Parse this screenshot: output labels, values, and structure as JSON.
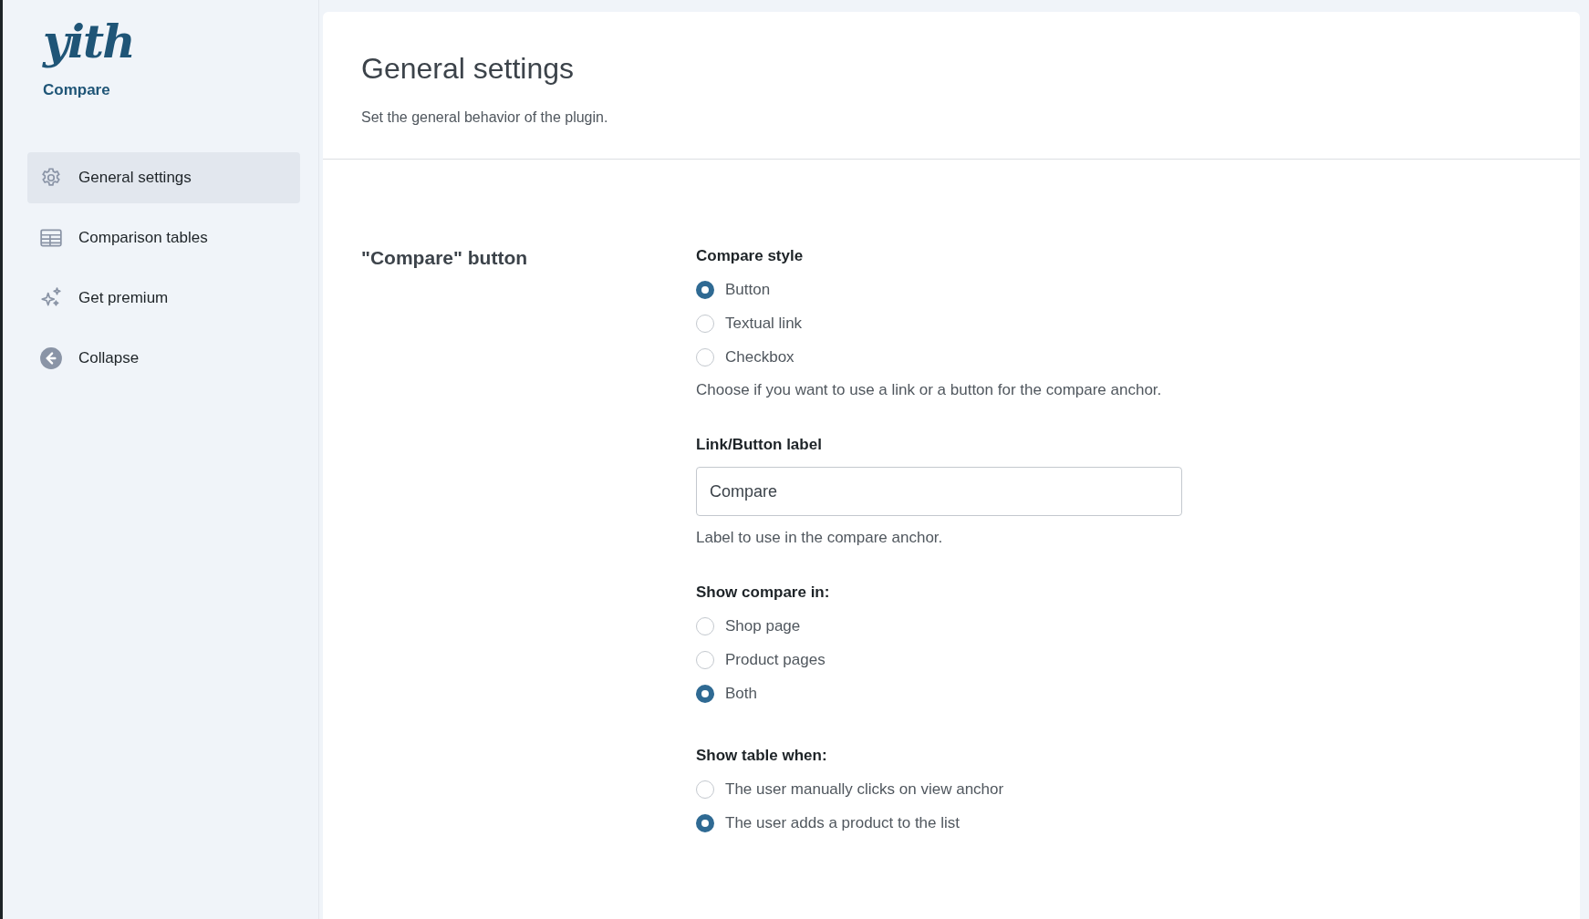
{
  "sidebar": {
    "logo": "yith",
    "product": "Compare",
    "items": [
      {
        "label": "General settings",
        "selected": true
      },
      {
        "label": "Comparison tables",
        "selected": false
      },
      {
        "label": "Get premium",
        "selected": false
      },
      {
        "label": "Collapse",
        "selected": false
      }
    ]
  },
  "page": {
    "title": "General settings",
    "subtitle": "Set the general behavior of the plugin."
  },
  "section": {
    "title": "\"Compare\" button",
    "fields": [
      {
        "kind": "radio",
        "label": "Compare style",
        "options": [
          {
            "label": "Button",
            "selected": true
          },
          {
            "label": "Textual link",
            "selected": false
          },
          {
            "label": "Checkbox",
            "selected": false
          }
        ],
        "description": "Choose if you want to use a link or a button for the compare anchor."
      },
      {
        "kind": "text",
        "label": "Link/Button label",
        "value": "Compare",
        "description": "Label to use in the compare anchor."
      },
      {
        "kind": "radio",
        "label": "Show compare in:",
        "options": [
          {
            "label": "Shop page",
            "selected": false
          },
          {
            "label": "Product pages",
            "selected": false
          },
          {
            "label": "Both",
            "selected": true
          }
        ]
      },
      {
        "kind": "radio",
        "label": "Show table when:",
        "options": [
          {
            "label": "The user manually clicks on view anchor",
            "selected": false
          },
          {
            "label": "The user adds a product to the list",
            "selected": true
          }
        ]
      }
    ]
  }
}
